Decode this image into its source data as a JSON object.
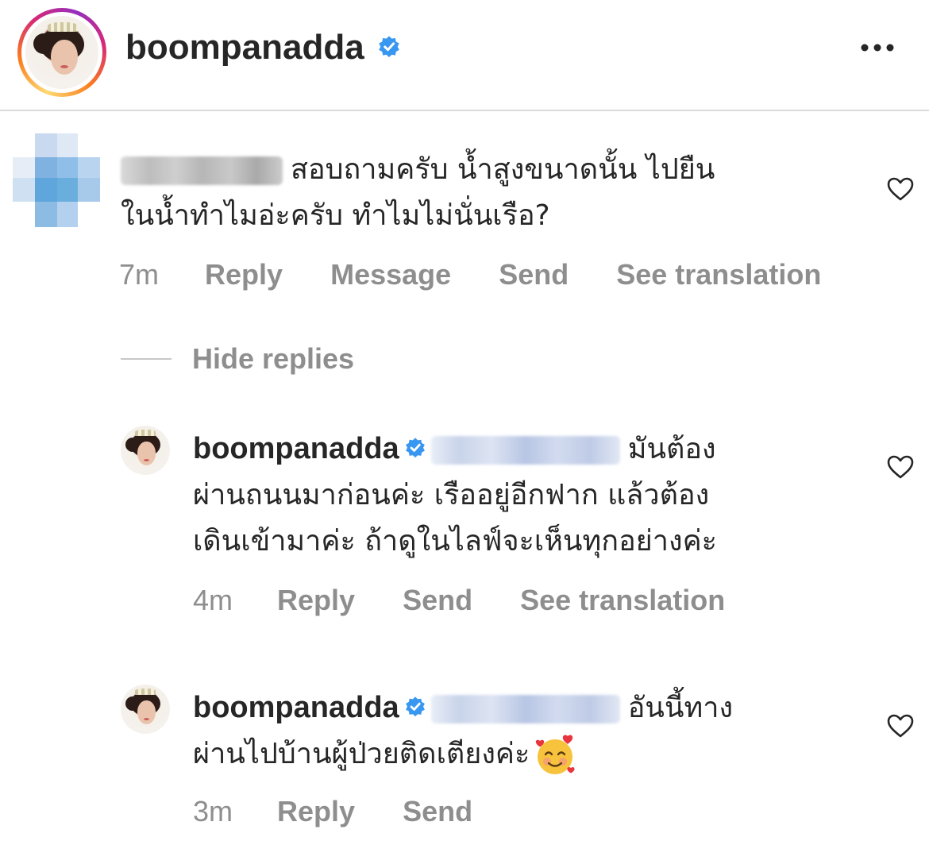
{
  "header": {
    "username": "boompanadda",
    "verified_icon": "verified-badge-icon",
    "more_icon": "more-options-icon"
  },
  "comment": {
    "text_line1": "สอบถามครับ น้ำสูงขนาดนั้น ไปยืน",
    "text_line2": "ในน้ำทำไมอ่ะครับ ทำไมไม่นั่นเรือ?",
    "time": "7m",
    "actions": [
      "Reply",
      "Message",
      "Send",
      "See translation"
    ]
  },
  "hide_replies_label": "Hide replies",
  "replies": [
    {
      "username": "boompanadda",
      "text_line1": "มันต้อง",
      "text_line2": "ผ่านถนนมาก่อนค่ะ เรืออยู่อีกฟาก แล้วต้อง",
      "text_line3": "เดินเข้ามาค่ะ ถ้าดูในไลฟ์จะเห็นทุกอย่างค่ะ",
      "time": "4m",
      "actions": [
        "Reply",
        "Send",
        "See translation"
      ]
    },
    {
      "username": "boompanadda",
      "text_line1": "อันนี้ทาง",
      "text_line2": "ผ่านไปบ้านผู้ป่วยติดเตียงค่ะ",
      "emoji": "smiling-face-with-hearts-emoji",
      "time": "3m",
      "actions": [
        "Reply",
        "Send"
      ]
    }
  ],
  "colors": {
    "text": "#262626",
    "meta": "#8e8e8e",
    "verified_blue": "#3897f0",
    "divider": "#dbdbdb"
  }
}
